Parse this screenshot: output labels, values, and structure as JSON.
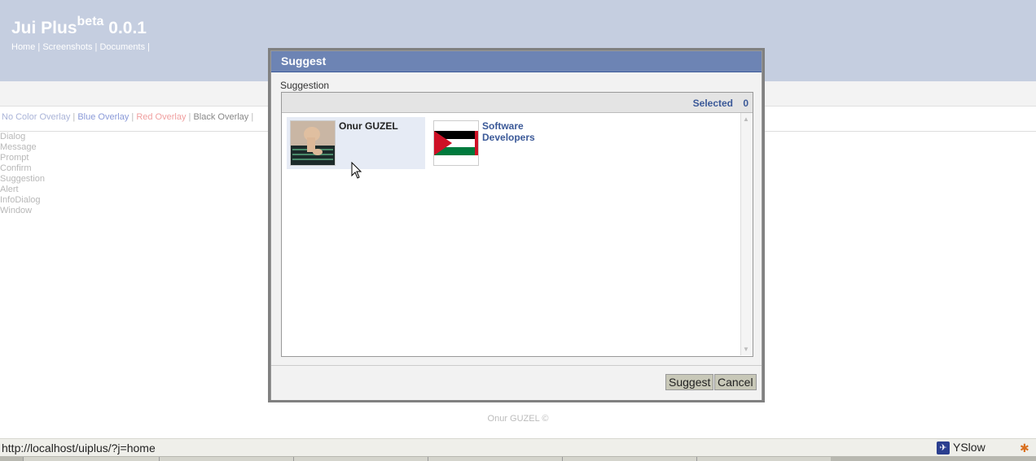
{
  "app": {
    "title": "Jui Plus",
    "beta": "beta",
    "version": "0.0.1"
  },
  "nav": {
    "home": "Home",
    "screenshots": "Screenshots",
    "documents": "Documents",
    "sep": "|"
  },
  "overlays": {
    "none": "No Color Overlay",
    "blue": "Blue Overlay",
    "red": "Red Overlay",
    "black": "Black Overlay",
    "sep": "|"
  },
  "menu": [
    "Dialog",
    "Message",
    "Prompt",
    "Confirm",
    "Suggestion",
    "Alert",
    "InfoDialog",
    "Window"
  ],
  "dialog": {
    "title": "Suggest",
    "label": "Suggestion",
    "selected_label": "Selected",
    "selected_count": "0",
    "items": [
      {
        "name": "Onur GUZEL",
        "selected": true,
        "icon": "person-photo"
      },
      {
        "name": "Software Developers",
        "selected": false,
        "icon": "palestine-flag"
      }
    ],
    "suggest_button": "Suggest",
    "cancel_button": "Cancel"
  },
  "footer": "Onur GUZEL ©",
  "status": {
    "url": "http://localhost/uiplus/?j=home",
    "yslow": "YSlow"
  },
  "colors": {
    "header": "#c5cee0",
    "dialog_title": "#6d84b4",
    "link": "#3b5998"
  }
}
